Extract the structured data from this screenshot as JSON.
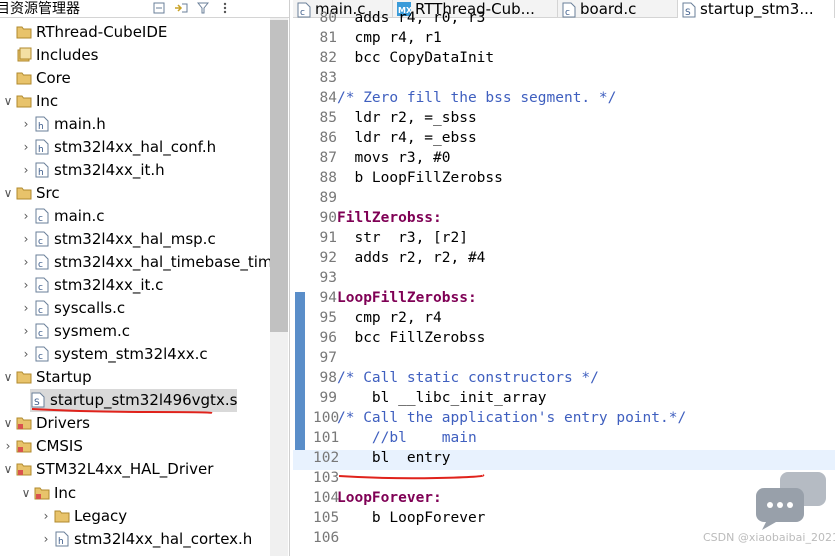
{
  "explorer": {
    "title": "目资源管理器",
    "tree": [
      {
        "label": "RThread-CubeIDE",
        "level": 0,
        "expand": "",
        "icon": "project-icon"
      },
      {
        "label": "Includes",
        "level": 0,
        "expand": "",
        "icon": "includes-icon"
      },
      {
        "label": "Core",
        "level": 0,
        "expand": "",
        "icon": "folder-icon"
      },
      {
        "label": "Inc",
        "level": 1,
        "expand": "v",
        "icon": "folder-icon"
      },
      {
        "label": "main.h",
        "level": 2,
        "expand": ">",
        "icon": "h-file-icon"
      },
      {
        "label": "stm32l4xx_hal_conf.h",
        "level": 2,
        "expand": ">",
        "icon": "h-file-icon"
      },
      {
        "label": "stm32l4xx_it.h",
        "level": 2,
        "expand": ">",
        "icon": "h-file-icon"
      },
      {
        "label": "Src",
        "level": 1,
        "expand": "v",
        "icon": "folder-icon"
      },
      {
        "label": "main.c",
        "level": 2,
        "expand": ">",
        "icon": "c-file-icon"
      },
      {
        "label": "stm32l4xx_hal_msp.c",
        "level": 2,
        "expand": ">",
        "icon": "c-file-icon"
      },
      {
        "label": "stm32l4xx_hal_timebase_tim.",
        "level": 2,
        "expand": ">",
        "icon": "c-file-icon"
      },
      {
        "label": "stm32l4xx_it.c",
        "level": 2,
        "expand": ">",
        "icon": "c-file-icon"
      },
      {
        "label": "syscalls.c",
        "level": 2,
        "expand": ">",
        "icon": "c-file-icon"
      },
      {
        "label": "sysmem.c",
        "level": 2,
        "expand": ">",
        "icon": "c-file-icon"
      },
      {
        "label": "system_stm32l4xx.c",
        "level": 2,
        "expand": ">",
        "icon": "c-file-icon"
      },
      {
        "label": "Startup",
        "level": 1,
        "expand": "v",
        "icon": "folder-icon"
      },
      {
        "label": "startup_stm32l496vgtx.s",
        "level": 2,
        "expand": ">",
        "icon": "s-file-icon",
        "selected": true
      },
      {
        "label": "Drivers",
        "level": 0,
        "expand": "v",
        "icon": "src-folder-icon"
      },
      {
        "label": "CMSIS",
        "level": 1,
        "expand": ">",
        "icon": "src-folder-icon"
      },
      {
        "label": "STM32L4xx_HAL_Driver",
        "level": 1,
        "expand": "v",
        "icon": "src-folder-icon"
      },
      {
        "label": "Inc",
        "level": 2,
        "expand": "v",
        "icon": "src-folder-icon"
      },
      {
        "label": "Legacy",
        "level": 3,
        "expand": ">",
        "icon": "folder-icon"
      },
      {
        "label": "stm32l4xx_hal_cortex.h",
        "level": 3,
        "expand": ">",
        "icon": "h-file-icon"
      }
    ]
  },
  "tabs": [
    {
      "label": "main.c",
      "icon": "c-file-icon",
      "active": false
    },
    {
      "label": "RTThread-Cub...",
      "icon": "mx-icon",
      "active": false
    },
    {
      "label": "board.c",
      "icon": "c-file-icon",
      "active": false
    },
    {
      "label": "startup_stm3...",
      "icon": "s-file-icon",
      "active": true
    }
  ],
  "code": [
    {
      "n": "80",
      "t": "  adds r4, r0, r3",
      "kind": "code"
    },
    {
      "n": "81",
      "t": "  cmp r4, r1",
      "kind": "code"
    },
    {
      "n": "82",
      "t": "  bcc CopyDataInit",
      "kind": "code"
    },
    {
      "n": "83",
      "t": "",
      "kind": "code"
    },
    {
      "n": "84",
      "t": "/* Zero fill the bss segment. */",
      "kind": "comment"
    },
    {
      "n": "85",
      "t": "  ldr r2, =_sbss",
      "kind": "code"
    },
    {
      "n": "86",
      "t": "  ldr r4, =_ebss",
      "kind": "code"
    },
    {
      "n": "87",
      "t": "  movs r3, #0",
      "kind": "code"
    },
    {
      "n": "88",
      "t": "  b LoopFillZerobss",
      "kind": "code"
    },
    {
      "n": "89",
      "t": "",
      "kind": "code"
    },
    {
      "n": "90",
      "t": "FillZerobss:",
      "kind": "label"
    },
    {
      "n": "91",
      "t": "  str  r3, [r2]",
      "kind": "code"
    },
    {
      "n": "92",
      "t": "  adds r2, r2, #4",
      "kind": "code"
    },
    {
      "n": "93",
      "t": "",
      "kind": "code"
    },
    {
      "n": "94",
      "t": "LoopFillZerobss:",
      "kind": "label"
    },
    {
      "n": "95",
      "t": "  cmp r2, r4",
      "kind": "code"
    },
    {
      "n": "96",
      "t": "  bcc FillZerobss",
      "kind": "code"
    },
    {
      "n": "97",
      "t": "",
      "kind": "code"
    },
    {
      "n": "98",
      "t": "/* Call static constructors */",
      "kind": "comment"
    },
    {
      "n": "99",
      "t": "    bl __libc_init_array",
      "kind": "code"
    },
    {
      "n": "100",
      "t": "/* Call the application's entry point.*/",
      "kind": "comment"
    },
    {
      "n": "101",
      "t": "    //bl    main",
      "kind": "comment"
    },
    {
      "n": "102",
      "t": "    bl  entry",
      "kind": "code",
      "current": true
    },
    {
      "n": "103",
      "t": "",
      "kind": "code"
    },
    {
      "n": "104",
      "t": "LoopForever:",
      "kind": "label"
    },
    {
      "n": "105",
      "t": "    b LoopForever",
      "kind": "code"
    },
    {
      "n": "106",
      "t": "",
      "kind": "code"
    }
  ],
  "watermark": "CSDN @xiaobaibai_2021",
  "colors": {
    "accent_red": "#e0221b",
    "gutter_blue": "#5a8ec9",
    "label_purple": "#7f0055",
    "comment_blue": "#3f5fbf"
  }
}
